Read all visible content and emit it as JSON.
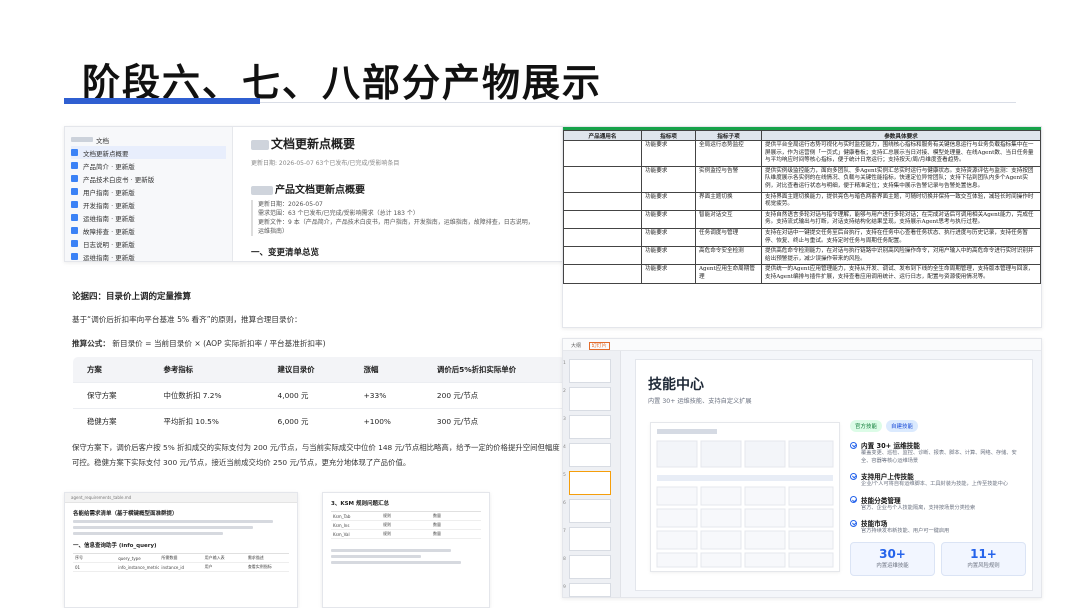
{
  "page": {
    "title": "阶段六、七、八部分产物展示",
    "accent_color": "#2f5fd1"
  },
  "doc_panel": {
    "sidebar_items": [
      {
        "label": "文档"
      },
      {
        "label": "文档更新点概要"
      },
      {
        "label": "产品简介 · 更新版"
      },
      {
        "label": "产品技术白皮书 · 更新版"
      },
      {
        "label": "用户指南 · 更新版"
      },
      {
        "label": "开发指南 · 更新版"
      },
      {
        "label": "运维指南 · 更新版"
      },
      {
        "label": "故障排查 · 更新版"
      },
      {
        "label": "日志说明 · 更新版"
      },
      {
        "label": "运维指南 · 更新版"
      }
    ],
    "title": "文档更新点概要",
    "meta": "更新日期: 2026-05-07  63个已发布/已完成/受影响条目",
    "subtitle": "产品文档更新点概要",
    "info_lines": [
      "更新日期：2026-05-07",
      "需求范围：63 个已发布/已完成/受影响需求（总计 183 个）",
      "更新文件：9 本（产品简介，产品技术白皮书，用户指南，开发指南，运维指南，故障排查，日志说明，",
      "运维指南）"
    ],
    "section": "一、变更清单总览"
  },
  "reason_panel": {
    "heading": "论据四：目录价上调的定量推算",
    "para1": "基于“调价后折扣率向平台基准 5% 看齐”的原则，推算合理目录价：",
    "formula_label": "推算公式：",
    "formula_text": "新目录价 = 当前目录价 × (AOP 实际折扣率 / 平台基准折扣率)",
    "columns": [
      "方案",
      "参考指标",
      "建议目录价",
      "涨幅",
      "调价后5%折扣实际单价"
    ],
    "rows": [
      [
        "保守方案",
        "中位数折扣 7.2%",
        "4,000 元",
        "+33%",
        "200 元/节点"
      ],
      [
        "稳健方案",
        "平均折扣 10.5%",
        "6,000 元",
        "+100%",
        "300 元/节点"
      ]
    ],
    "para2": "保守方案下，调价后客户按 5% 折扣成交的实际支付为 200 元/节点，与当前实际成交中位价 148 元/节点相比略高，给予一定的价格提升空间但幅度可控。稳健方案下实际支付 300 元/节点，接近当前成交均价 250 元/节点，更充分地体现了产品价值。"
  },
  "list_panel": {
    "bar": "agent_requirements_table.md",
    "heading": "各能给需求清单（基于横键概型面准群提）",
    "sub": "一、信息查询助手 (info_query)",
    "table_head": [
      "序号",
      "query_type",
      "所需数据",
      "用户输入表",
      "需求描述"
    ],
    "table_rows": [
      [
        "01",
        "info_instance_metrics",
        "instance_id",
        "用户",
        "查看实例指标"
      ]
    ]
  },
  "detail_panel": {
    "heading": "3、KSM 规则问题汇总",
    "table_rows": [
      [
        "Ksm_Tab",
        "规则",
        "数量"
      ],
      [
        "Ksm_Ins",
        "规则",
        "数量"
      ],
      [
        "Ksm_Val",
        "规则",
        "数量"
      ]
    ]
  },
  "matrix_panel": {
    "columns": [
      "产品通用名",
      "指标项",
      "指标子项",
      "参数具体要求"
    ],
    "rows": [
      [
        "",
        "功能要求",
        "全局运行态势监控",
        "提供平台全局运行态势可视化与实时监控能力，围绕核心指标和服务有关键信息运行与业务负载指标集中在一屏展示，作为运营侧「一页式」健康看板；支持汇总展示当日对接、模型处理量、在线Agent数、当日任务量与平均响应时间等核心指标，便于统计日常运行；支持按天/周/月维度查看趋势。"
      ],
      [
        "",
        "功能要求",
        "实例监控与告警",
        "提供实例级监控能力，面向多团队、多Agent实例汇总实时运行与健康状态。支持资源评估与监测：支持按团队维度展示各实例的在线情况、负载与关键性能指标，快速定位异常团队；支持下钻到团队内多个Agent实例，对比查看运行状态与明细，便于精准定位；支持集中展示告警记录与告警处置信息。"
      ],
      [
        "",
        "功能要求",
        "界面主题切换",
        "支持界面主题切换能力，提供亮色与暗色两套界面主题，可随时切换并保持一致交互体验，减轻长时间操作时视觉疲劳。"
      ],
      [
        "",
        "功能要求",
        "智能对话交互",
        "支持自然语言多轮对话与指令理解，能够与用户进行多轮对话；在完成对话后可调用相关Agent能力，完成任务。支持流式输出与打断，对话支持结构化结果呈现，支持展示Agent思考与执行过程。"
      ],
      [
        "",
        "功能要求",
        "任务调度与管理",
        "支持在对话中一键提交任务至后台执行，支持在任务中心查看任务状态、执行进度与历史记录，支持任务暂停、恢复、终止与重试。支持定时任务与周期任务配置。"
      ],
      [
        "",
        "功能要求",
        "高危命令安全检测",
        "提供高危命令检测能力，在对话与执行链路中识别高风险操作命令，对用户输入中的高危命令进行实时识别并给出预警提示，减少误操作带来的风险。"
      ],
      [
        "",
        "功能要求",
        "Agent应用生命周期管理",
        "提供统一的Agent应用管理能力，支持从开发、调试、发布到下线的全生命周期管理，支持版本管理与回滚，支持Agent编排与插件扩展，支持查看应用调用统计、运行日志，配置与资源使用情况等。"
      ]
    ]
  },
  "skill_panel": {
    "top_label": "大纲",
    "top_tab": "幻灯片",
    "title": "技能中心",
    "subtitle": "内置 30+ 运维技能、支持自定义扩展",
    "badge1": "官方技能",
    "badge2": "自建技能",
    "features": [
      {
        "title": "内置 30+ 运维技能",
        "desc": "覆盖变更、巡检、监控、诊断、报表、脚本、计算、网络、存储、安全、容器等核心运维场景"
      },
      {
        "title": "支持用户上传技能",
        "desc": "企业/个人可将自有运维脚本、工具封装为技能，上传至技能中心"
      },
      {
        "title": "技能分类管理",
        "desc": "官方、企业与个人技能隔离，支持按场景分类检索"
      },
      {
        "title": "技能市场",
        "desc": "官方持续发布新技能、用户可一键启用"
      }
    ],
    "stats": [
      {
        "value": "30+",
        "label": "内置运维技能"
      },
      {
        "value": "11+",
        "label": "内置风险规则"
      }
    ],
    "thumb_numbers": [
      "1",
      "2",
      "3",
      "4",
      "5",
      "6",
      "7",
      "8",
      "9"
    ]
  }
}
